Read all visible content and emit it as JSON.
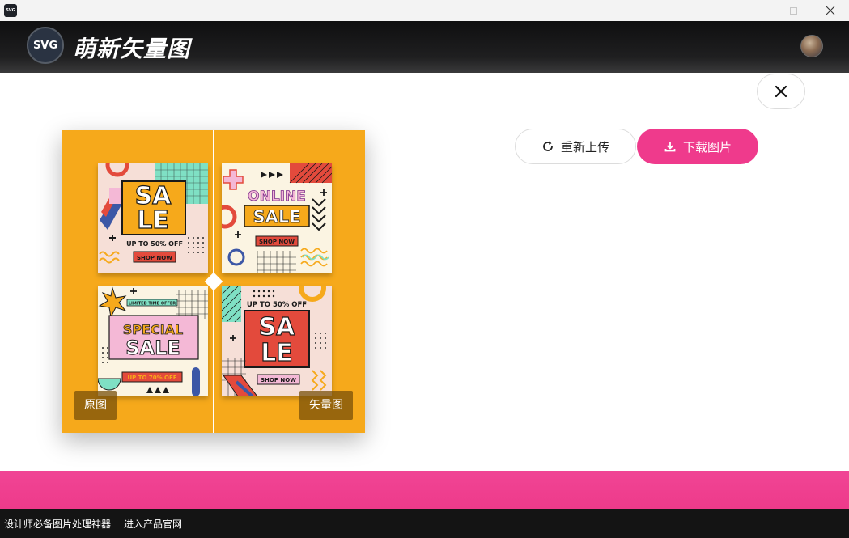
{
  "os": {
    "app_icon": "svg-app-icon",
    "app_icon_text": "SVG"
  },
  "header": {
    "logo_text": "SVG",
    "app_name": "萌新矢量图"
  },
  "actions": {
    "reupload_label": "重新上传",
    "download_label": "下载图片"
  },
  "compare": {
    "left_label": "原图",
    "right_label": "矢量图"
  },
  "cards": {
    "card1": {
      "big1": "SA",
      "big2": "LE",
      "sub": "UP TO 50% OFF",
      "btn": "SHOP NOW"
    },
    "card2": {
      "line1": "ONLINE",
      "line2": "SALE",
      "btn": "SHOP NOW"
    },
    "card3": {
      "tag": "LIMITED TIME OFFER",
      "line1": "SPECIAL",
      "line2": "SALE",
      "sub": "UP TO 70% OFF"
    },
    "card4": {
      "top": "UP TO 50% OFF",
      "big1": "SA",
      "big2": "LE",
      "btn": "SHOP NOW"
    }
  },
  "colors": {
    "accent": "#ef3a8c",
    "compare_bg": "#f6a91b",
    "header_bg": "#1a1a1a"
  },
  "footer": {
    "tagline": "设计师必备图片处理神器",
    "link": "进入产品官网"
  }
}
